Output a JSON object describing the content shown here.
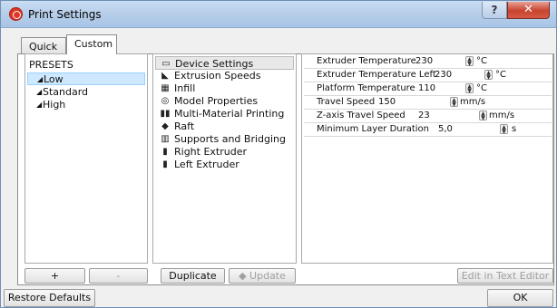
{
  "window": {
    "title": "Print Settings",
    "help_label": "?",
    "close_label": "✕"
  },
  "tabs": [
    {
      "label": "Quick"
    },
    {
      "label": "Custom"
    }
  ],
  "presets": {
    "heading": "PRESETS",
    "items": [
      {
        "label": "Low",
        "marker": "◢"
      },
      {
        "label": "Standard",
        "marker": "◢"
      },
      {
        "label": "High",
        "marker": "◢"
      }
    ]
  },
  "categories": [
    {
      "label": "Device Settings",
      "icon": "monitor-icon",
      "glyph": "▭"
    },
    {
      "label": "Extrusion Speeds",
      "icon": "extruder-icon",
      "glyph": "◣"
    },
    {
      "label": "Infill",
      "icon": "infill-icon",
      "glyph": "▦"
    },
    {
      "label": "Model Properties",
      "icon": "model-icon",
      "glyph": "◎"
    },
    {
      "label": "Multi-Material Printing",
      "icon": "multi-material-icon",
      "glyph": "▮▮"
    },
    {
      "label": "Raft",
      "icon": "raft-icon",
      "glyph": "◆"
    },
    {
      "label": "Supports and Bridging",
      "icon": "supports-icon",
      "glyph": "▥"
    },
    {
      "label": "Right Extruder",
      "icon": "right-extruder-icon",
      "glyph": "▮"
    },
    {
      "label": "Left Extruder",
      "icon": "left-extruder-icon",
      "glyph": "▮"
    }
  ],
  "properties": [
    {
      "label": "Extruder Temperature",
      "value": "230",
      "unit": "°C"
    },
    {
      "label": "Extruder Temperature Left",
      "value": "230",
      "unit": "°C"
    },
    {
      "label": "Platform Temperature",
      "value": "110",
      "unit": "°C"
    },
    {
      "label": "Travel Speed",
      "value": "150",
      "unit": "mm/s"
    },
    {
      "label": "Z-axis Travel Speed",
      "value": "23",
      "unit": "mm/s"
    },
    {
      "label": "Minimum Layer Duration",
      "value": "5,0",
      "unit": "s"
    }
  ],
  "buttons": {
    "add": "+",
    "remove": "-",
    "duplicate": "Duplicate",
    "update": "◆ Update",
    "edit_in_text_editor": "Edit in Text Editor",
    "restore_defaults": "Restore Defaults",
    "ok": "OK"
  }
}
